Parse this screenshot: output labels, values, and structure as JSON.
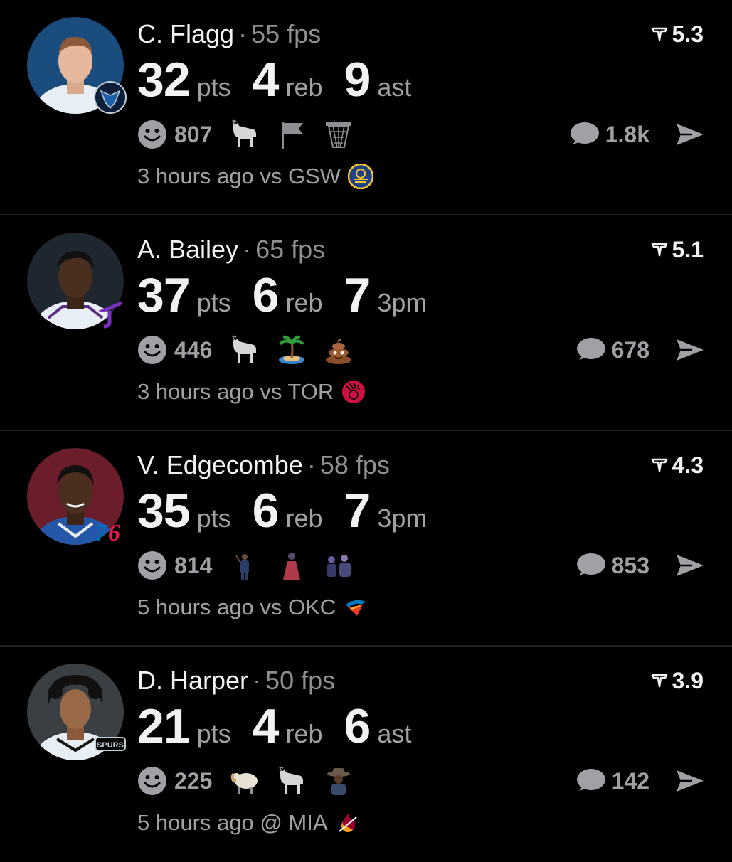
{
  "feed": [
    {
      "name": "C. Flagg",
      "separator": "·",
      "fps": "55 fps",
      "rating": "5.3",
      "stats": [
        {
          "num": "32",
          "label": "pts"
        },
        {
          "num": "4",
          "label": "reb"
        },
        {
          "num": "9",
          "label": "ast"
        }
      ],
      "reactions_count": "807",
      "emojis": [
        "goat-emoji",
        "flag-emoji",
        "basketball-hoop-emoji"
      ],
      "comments_count": "1.8k",
      "time_text": "3 hours ago vs GSW",
      "team_logo": "mavericks-logo",
      "opponent_logo": "warriors-logo",
      "avatar_bg": "#1b4c7e"
    },
    {
      "name": "A. Bailey",
      "separator": "·",
      "fps": "65 fps",
      "rating": "5.1",
      "stats": [
        {
          "num": "37",
          "label": "pts"
        },
        {
          "num": "6",
          "label": "reb"
        },
        {
          "num": "7",
          "label": "3pm"
        }
      ],
      "reactions_count": "446",
      "emojis": [
        "goat-emoji",
        "desert-island-emoji",
        "poop-emoji"
      ],
      "comments_count": "678",
      "time_text": "3 hours ago vs TOR",
      "team_logo": "jazz-logo",
      "opponent_logo": "raptors-logo",
      "avatar_bg": "#1e2630"
    },
    {
      "name": "V. Edgecombe",
      "separator": "·",
      "fps": "58 fps",
      "rating": "4.3",
      "stats": [
        {
          "num": "35",
          "label": "pts"
        },
        {
          "num": "6",
          "label": "reb"
        },
        {
          "num": "7",
          "label": "3pm"
        }
      ],
      "reactions_count": "814",
      "emojis": [
        "person-emoji",
        "person-dress-emoji",
        "group-emoji"
      ],
      "comments_count": "853",
      "time_text": "5 hours ago vs OKC",
      "team_logo": "76ers-logo",
      "opponent_logo": "thunder-logo",
      "avatar_bg": "#6b1d2a"
    },
    {
      "name": "D. Harper",
      "separator": "·",
      "fps": "50 fps",
      "rating": "3.9",
      "stats": [
        {
          "num": "21",
          "label": "pts"
        },
        {
          "num": "4",
          "label": "reb"
        },
        {
          "num": "6",
          "label": "ast"
        }
      ],
      "reactions_count": "225",
      "emojis": [
        "ram-emoji",
        "goat-emoji",
        "cowboy-emoji"
      ],
      "comments_count": "142",
      "time_text": "5 hours ago @ MIA",
      "team_logo": "spurs-logo",
      "opponent_logo": "heat-logo",
      "avatar_bg": "#3a3f44"
    }
  ],
  "colors": {
    "background": "#000000",
    "primary_text": "#f2f2f2",
    "secondary_text": "#a0a0a5",
    "divider": "#1f1f1f"
  }
}
